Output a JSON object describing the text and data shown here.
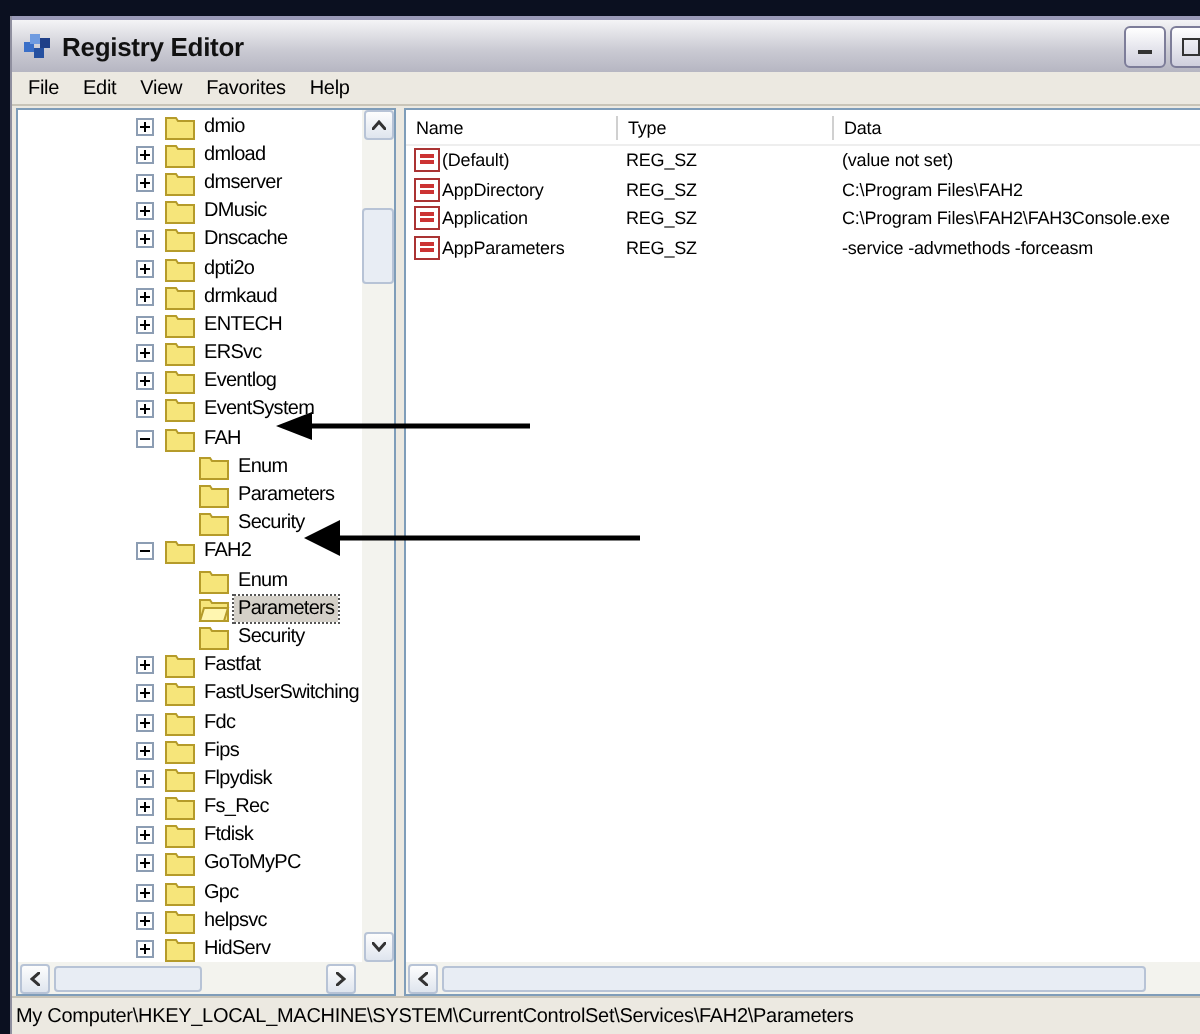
{
  "window": {
    "title": "Registry Editor"
  },
  "menu": [
    "File",
    "Edit",
    "View",
    "Favorites",
    "Help"
  ],
  "tree": [
    {
      "label": "dmio",
      "expanded": false,
      "selected": false
    },
    {
      "label": "dmload",
      "expanded": false,
      "selected": false
    },
    {
      "label": "dmserver",
      "expanded": false,
      "selected": false
    },
    {
      "label": "DMusic",
      "expanded": false,
      "selected": false
    },
    {
      "label": "Dnscache",
      "expanded": false,
      "selected": false
    },
    {
      "label": "dpti2o",
      "expanded": false,
      "selected": false
    },
    {
      "label": "drmkaud",
      "expanded": false,
      "selected": false
    },
    {
      "label": "ENTECH",
      "expanded": false,
      "selected": false
    },
    {
      "label": "ERSvc",
      "expanded": false,
      "selected": false
    },
    {
      "label": "Eventlog",
      "expanded": false,
      "selected": false
    },
    {
      "label": "EventSystem",
      "expanded": false,
      "selected": false
    },
    {
      "label": "FAH",
      "expanded": true,
      "selected": false,
      "children": [
        {
          "label": "Enum",
          "selected": false
        },
        {
          "label": "Parameters",
          "selected": false
        },
        {
          "label": "Security",
          "selected": false
        }
      ]
    },
    {
      "label": "FAH2",
      "expanded": true,
      "selected": false,
      "children": [
        {
          "label": "Enum",
          "selected": false
        },
        {
          "label": "Parameters",
          "selected": true
        },
        {
          "label": "Security",
          "selected": false
        }
      ]
    },
    {
      "label": "Fastfat",
      "expanded": false,
      "selected": false
    },
    {
      "label": "FastUserSwitching",
      "expanded": false,
      "selected": false
    },
    {
      "label": "Fdc",
      "expanded": false,
      "selected": false
    },
    {
      "label": "Fips",
      "expanded": false,
      "selected": false
    },
    {
      "label": "Flpydisk",
      "expanded": false,
      "selected": false
    },
    {
      "label": "Fs_Rec",
      "expanded": false,
      "selected": false
    },
    {
      "label": "Ftdisk",
      "expanded": false,
      "selected": false
    },
    {
      "label": "GoToMyPC",
      "expanded": false,
      "selected": false
    },
    {
      "label": "Gpc",
      "expanded": false,
      "selected": false
    },
    {
      "label": "helpsvc",
      "expanded": false,
      "selected": false
    },
    {
      "label": "HidServ",
      "expanded": false,
      "selected": false
    }
  ],
  "values": {
    "columns": [
      "Name",
      "Type",
      "Data"
    ],
    "rows": [
      {
        "name": "(Default)",
        "type": "REG_SZ",
        "data": "(value not set)"
      },
      {
        "name": "AppDirectory",
        "type": "REG_SZ",
        "data": "C:\\Program Files\\FAH2"
      },
      {
        "name": "Application",
        "type": "REG_SZ",
        "data": "C:\\Program Files\\FAH2\\FAH3Console.exe"
      },
      {
        "name": "AppParameters",
        "type": "REG_SZ",
        "data": "-service -advmethods -forceasm"
      }
    ]
  },
  "status_bar": "My Computer\\HKEY_LOCAL_MACHINE\\SYSTEM\\CurrentControlSet\\Services\\FAH2\\Parameters"
}
